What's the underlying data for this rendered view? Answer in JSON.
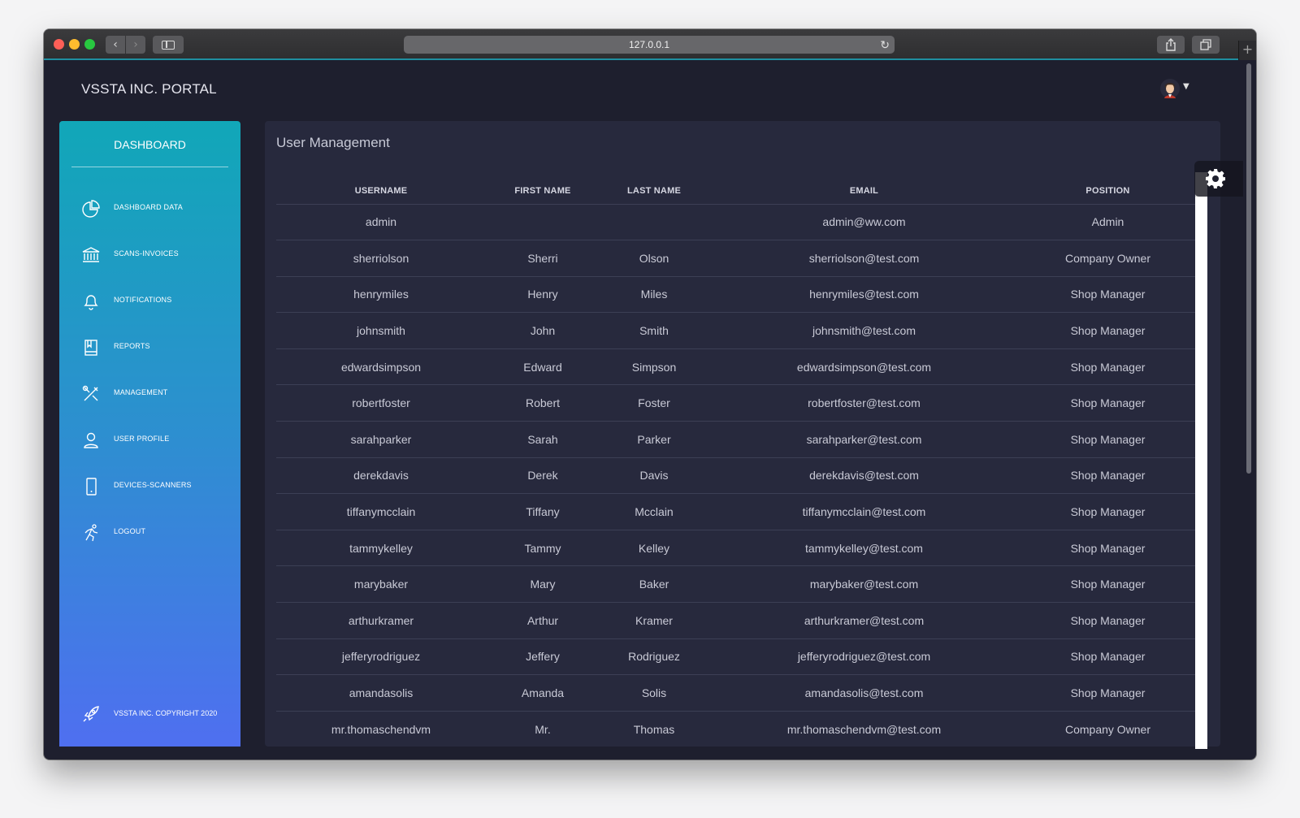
{
  "browser": {
    "url": "127.0.0.1"
  },
  "app": {
    "brand": "VSSTA INC. PORTAL"
  },
  "sidebar": {
    "title": "DASHBOARD",
    "items": [
      {
        "label": "DASHBOARD DATA",
        "icon": "pie-chart-icon"
      },
      {
        "label": "SCANS-INVOICES",
        "icon": "bank-icon"
      },
      {
        "label": "NOTIFICATIONS",
        "icon": "bell-icon"
      },
      {
        "label": "REPORTS",
        "icon": "book-icon"
      },
      {
        "label": "MANAGEMENT",
        "icon": "tools-icon"
      },
      {
        "label": "USER PROFILE",
        "icon": "user-icon"
      },
      {
        "label": "DEVICES-SCANNERS",
        "icon": "mobile-icon"
      },
      {
        "label": "LOGOUT",
        "icon": "running-icon"
      }
    ],
    "copyright": "VSSTA INC. COPYRIGHT 2020"
  },
  "main": {
    "title": "User Management",
    "columns": [
      "USERNAME",
      "FIRST NAME",
      "LAST NAME",
      "EMAIL",
      "POSITION"
    ],
    "rows": [
      [
        "admin",
        "",
        "",
        "admin@ww.com",
        "Admin"
      ],
      [
        "sherriolson",
        "Sherri",
        "Olson",
        "sherriolson@test.com",
        "Company Owner"
      ],
      [
        "henrymiles",
        "Henry",
        "Miles",
        "henrymiles@test.com",
        "Shop Manager"
      ],
      [
        "johnsmith",
        "John",
        "Smith",
        "johnsmith@test.com",
        "Shop Manager"
      ],
      [
        "edwardsimpson",
        "Edward",
        "Simpson",
        "edwardsimpson@test.com",
        "Shop Manager"
      ],
      [
        "robertfoster",
        "Robert",
        "Foster",
        "robertfoster@test.com",
        "Shop Manager"
      ],
      [
        "sarahparker",
        "Sarah",
        "Parker",
        "sarahparker@test.com",
        "Shop Manager"
      ],
      [
        "derekdavis",
        "Derek",
        "Davis",
        "derekdavis@test.com",
        "Shop Manager"
      ],
      [
        "tiffanymcclain",
        "Tiffany",
        "Mcclain",
        "tiffanymcclain@test.com",
        "Shop Manager"
      ],
      [
        "tammykelley",
        "Tammy",
        "Kelley",
        "tammykelley@test.com",
        "Shop Manager"
      ],
      [
        "marybaker",
        "Mary",
        "Baker",
        "marybaker@test.com",
        "Shop Manager"
      ],
      [
        "arthurkramer",
        "Arthur",
        "Kramer",
        "arthurkramer@test.com",
        "Shop Manager"
      ],
      [
        "jefferyrodriguez",
        "Jeffery",
        "Rodriguez",
        "jefferyrodriguez@test.com",
        "Shop Manager"
      ],
      [
        "amandasolis",
        "Amanda",
        "Solis",
        "amandasolis@test.com",
        "Shop Manager"
      ],
      [
        "mr.thomaschendvm",
        "Mr.",
        "Thomas",
        "mr.thomaschendvm@test.com",
        "Company Owner"
      ]
    ]
  },
  "colors": {
    "sidebar_gradient_top": "#11a7b8",
    "sidebar_gradient_bottom": "#4f6ff0",
    "page_bg": "#1e1f2e",
    "card_bg": "#27293d"
  }
}
